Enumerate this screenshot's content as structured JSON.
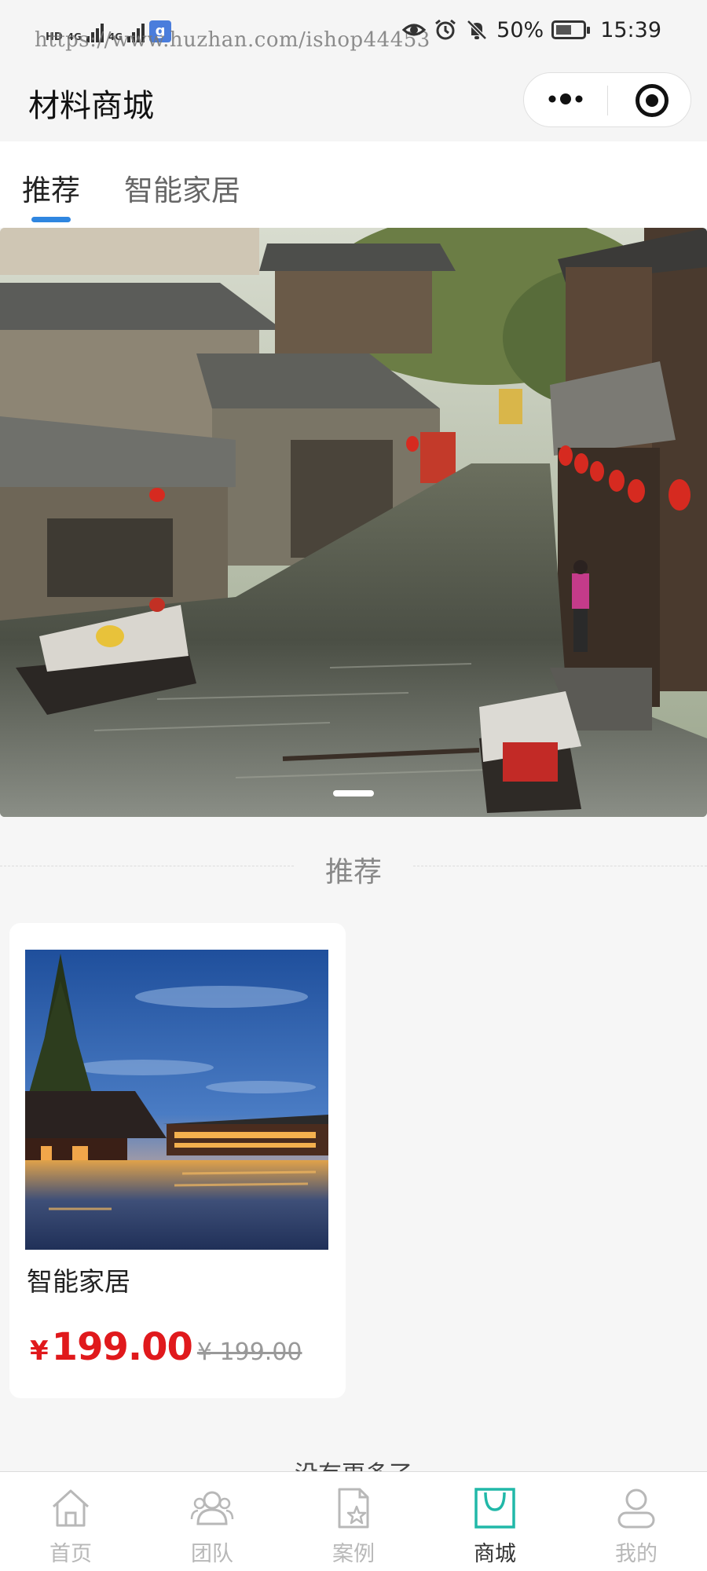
{
  "status_bar": {
    "signal_left": "HD",
    "network_1": "4G",
    "network_2": "4G",
    "watermark": "https://www.huzhan.com/ishop44453",
    "battery": "50%",
    "time": "15:39"
  },
  "nav": {
    "title": "材料商城"
  },
  "tabs": [
    {
      "label": "推荐",
      "active": true
    },
    {
      "label": "智能家居",
      "active": false
    }
  ],
  "banner": {
    "slide_count": 1,
    "current_slide": 1
  },
  "section": {
    "title": "推荐"
  },
  "products": [
    {
      "name": "智能家居",
      "currency": "¥",
      "price": "199.00",
      "original_price": "¥ 199.00"
    }
  ],
  "footer": {
    "no_more": "没有更多了"
  },
  "tab_bar": [
    {
      "label": "首页",
      "icon": "home-icon",
      "active": false
    },
    {
      "label": "团队",
      "icon": "team-icon",
      "active": false
    },
    {
      "label": "案例",
      "icon": "case-icon",
      "active": false
    },
    {
      "label": "商城",
      "icon": "shop-bag-icon",
      "active": true
    },
    {
      "label": "我的",
      "icon": "profile-icon",
      "active": false
    }
  ],
  "colors": {
    "accent_blue": "#2f86e0",
    "price_red": "#e0191c",
    "active_tab_icon": "#21b8a8"
  }
}
